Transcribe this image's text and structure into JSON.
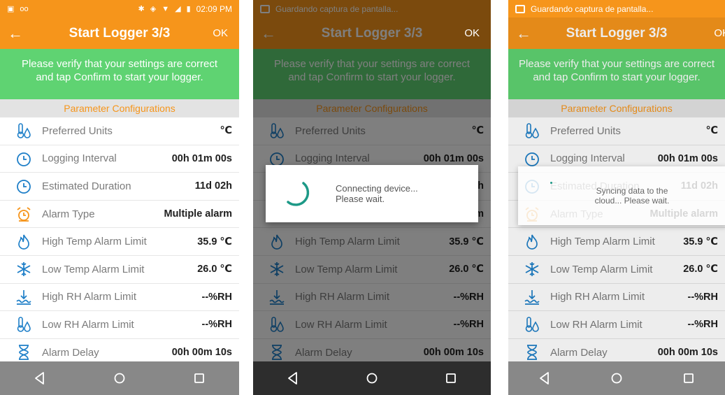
{
  "colors": {
    "brand": "#f6951b",
    "banner": "#5fd372",
    "section_header_text": "#f6951b",
    "icon_blue": "#1e7fc8",
    "icon_orange": "#f6951b",
    "spinner": "#1d9987"
  },
  "screen": {
    "title": "Start Logger 3/3",
    "ok_label": "OK",
    "back_icon": "arrow-left-icon",
    "banner_line1": "Please verify that your settings are correct",
    "banner_line2": "and tap Confirm to start your logger.",
    "section_header": "Parameter Configurations",
    "params": [
      {
        "label": "Preferred Units",
        "value": "℃",
        "icon": "thermometer-drop-icon"
      },
      {
        "label": "Logging Interval",
        "value": "00h 01m 00s",
        "icon": "clock-icon"
      },
      {
        "label": "Estimated Duration",
        "value": "11d 02h",
        "icon": "clock-icon"
      },
      {
        "label": "Alarm Type",
        "value": "Multiple alarm",
        "icon": "alarm-clock-icon"
      },
      {
        "label": "High Temp Alarm Limit",
        "value": "35.9 ℃",
        "icon": "flame-icon"
      },
      {
        "label": "Low Temp Alarm Limit",
        "value": "26.0 ℃",
        "icon": "snowflake-icon"
      },
      {
        "label": "High RH Alarm Limit",
        "value": "--%RH",
        "icon": "water-level-icon"
      },
      {
        "label": "Low RH Alarm Limit",
        "value": "--%RH",
        "icon": "thermometer-drop-icon"
      },
      {
        "label": "Alarm Delay",
        "value": "00h 00m 10s",
        "icon": "hourglass-icon"
      }
    ]
  },
  "phones": [
    {
      "status_time": "02:09 PM",
      "status_text": ""
    },
    {
      "status_text": "Guardando captura de pantalla...",
      "dialog": {
        "line1": "Connecting device...",
        "line2": "Please wait."
      }
    },
    {
      "status_text": "Guardando captura de pantalla...",
      "dialog": {
        "line1": "Syncing data to the",
        "line2": "cloud... Please wait."
      }
    }
  ],
  "nav": [
    "back-triangle-icon",
    "home-circle-icon",
    "recents-square-icon"
  ]
}
